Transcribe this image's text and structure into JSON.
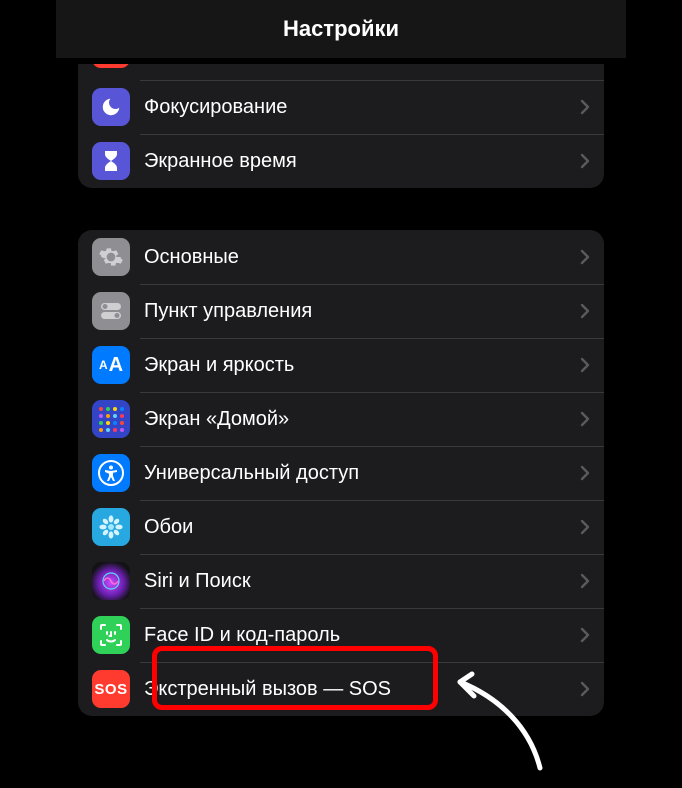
{
  "header": {
    "title": "Настройки"
  },
  "group1": {
    "focus_label": "Фокусирование",
    "screentime_label": "Экранное время"
  },
  "group2": {
    "general_label": "Основные",
    "control_label": "Пункт управления",
    "display_label": "Экран и яркость",
    "display_icon_text": "AA",
    "home_label": "Экран «Домой»",
    "access_label": "Универсальный доступ",
    "wallpaper_label": "Обои",
    "siri_label": "Siri и Поиск",
    "faceid_label": "Face ID и код-пароль",
    "sos_label": "Экстренный вызов — SOS",
    "sos_icon_text": "SOS"
  },
  "annotation": {
    "highlight": {
      "target": "faceid"
    }
  }
}
